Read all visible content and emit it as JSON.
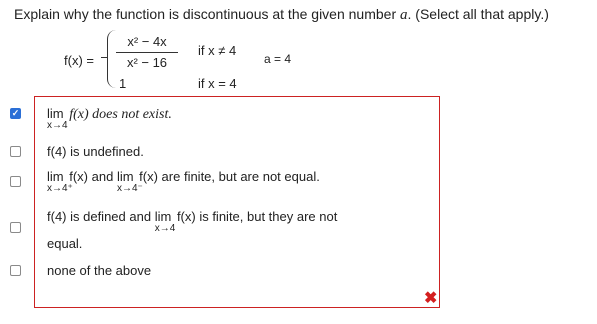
{
  "question": {
    "text_before": "Explain why the function is discontinuous at the given number ",
    "var": "a",
    "text_after": ". (Select all that apply.)"
  },
  "function": {
    "label": "f(x)  =",
    "numerator": "x² − 4x",
    "denominator": "x² − 16",
    "case1": "if x ≠ 4",
    "value2": "1",
    "case2": "if x = 4",
    "a_given": "a = 4"
  },
  "options": [
    {
      "lim": "lim",
      "sub": "x→4",
      "text": "f(x) does not exist.",
      "checked": true
    },
    {
      "text": "f(4) is undefined.",
      "checked": false
    },
    {
      "lim1": "lim",
      "sub1": "x→4⁺",
      "mid": "f(x) and",
      "lim2": "lim",
      "sub2": "x→4⁻",
      "text": "f(x) are finite, but are not equal.",
      "checked": false
    },
    {
      "text_a": "f(4) is defined and",
      "lim": "lim",
      "sub": "x→4",
      "text_b": "f(x) is finite, but they are not",
      "line2": "equal.",
      "checked": false
    },
    {
      "text": "none of the above",
      "checked": false
    }
  ],
  "feedback": {
    "icon": "✖",
    "color": "#d41f1f"
  }
}
